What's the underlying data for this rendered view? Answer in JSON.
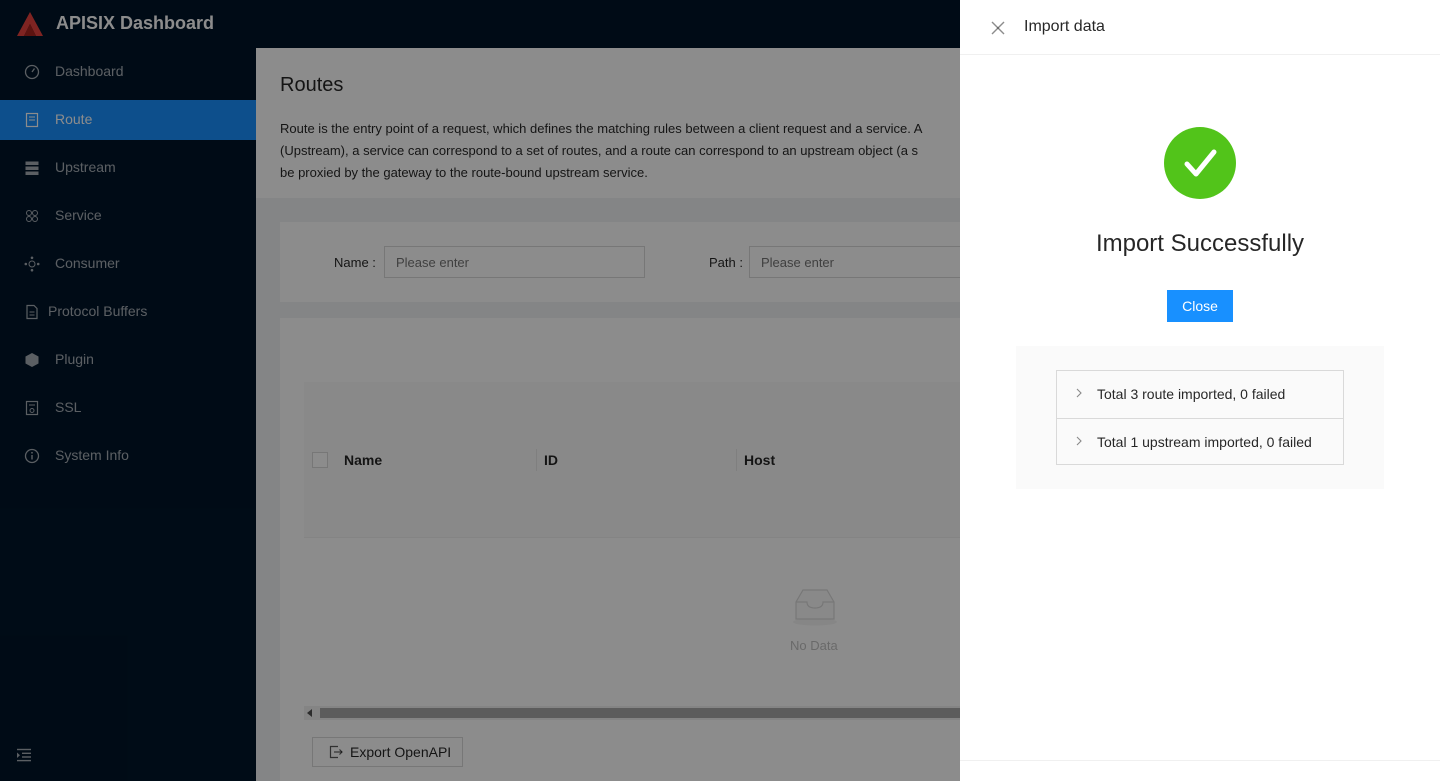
{
  "header": {
    "brand": "APISIX Dashboard"
  },
  "sidebar": {
    "items": [
      {
        "label": "Dashboard",
        "icon": "dashboard-icon"
      },
      {
        "label": "Route",
        "icon": "route-icon",
        "active": true
      },
      {
        "label": "Upstream",
        "icon": "upstream-icon"
      },
      {
        "label": "Service",
        "icon": "service-icon"
      },
      {
        "label": "Consumer",
        "icon": "consumer-icon"
      },
      {
        "label": "Protocol Buffers",
        "icon": "file-icon"
      },
      {
        "label": "Plugin",
        "icon": "plugin-icon"
      },
      {
        "label": "SSL",
        "icon": "ssl-icon"
      },
      {
        "label": "System Info",
        "icon": "info-icon"
      }
    ]
  },
  "page": {
    "title": "Routes",
    "description": [
      "Route is the entry point of a request, which defines the matching rules between a client request and a service. A",
      "(Upstream), a service can correspond to a set of routes, and a route can correspond to an upstream object (a s",
      "be proxied by the gateway to the route-bound upstream service."
    ]
  },
  "search": {
    "name_label": "Name",
    "name_placeholder": "Please enter",
    "path_label": "Path",
    "path_placeholder": "Please enter"
  },
  "table": {
    "columns": [
      "Name",
      "ID",
      "Host"
    ],
    "empty_text": "No Data",
    "export_label": "Export OpenAPI"
  },
  "drawer": {
    "title": "Import data",
    "result_title": "Import Successfully",
    "close_label": "Close",
    "panels": [
      "Total 3 route imported, 0 failed",
      "Total 1 upstream imported, 0 failed"
    ]
  },
  "colors": {
    "primary": "#1890ff",
    "success": "#52c41a",
    "sider": "#001529"
  }
}
